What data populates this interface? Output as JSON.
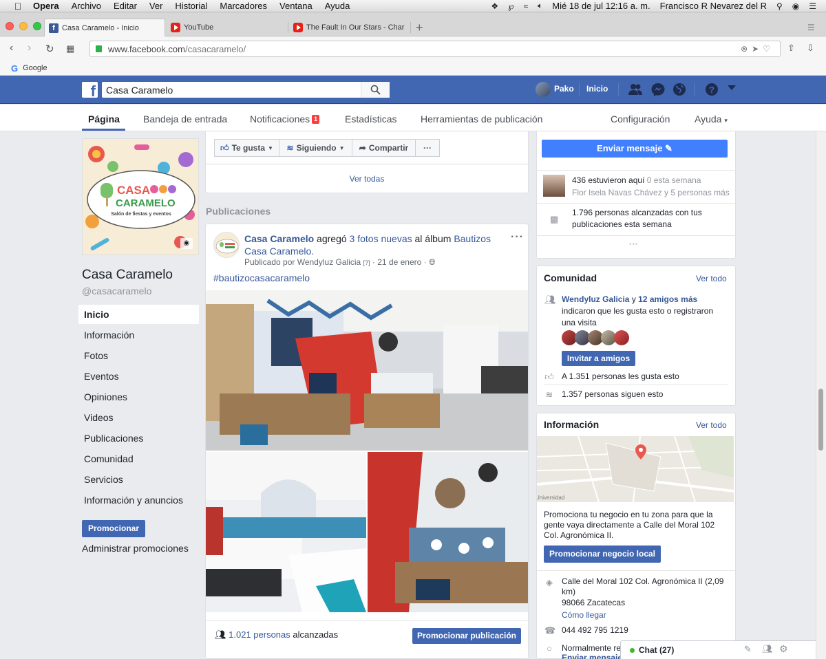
{
  "menubar": {
    "app": "Opera",
    "items": [
      "Archivo",
      "Editar",
      "Ver",
      "Historial",
      "Marcadores",
      "Ventana",
      "Ayuda"
    ],
    "datetime": "Mié 18 de jul  12:16 a. m.",
    "user": "Francisco R Nevarez del R"
  },
  "tabs": [
    {
      "title": "Casa Caramelo - Inicio",
      "icon": "facebook-icon",
      "active": true
    },
    {
      "title": "YouTube",
      "icon": "youtube-icon",
      "active": false
    },
    {
      "title": "The Fault In Our Stars - Char",
      "icon": "youtube-icon",
      "active": false
    }
  ],
  "address": {
    "host": "www.facebook.com",
    "path": "/casacaramelo/"
  },
  "bookmarks": [
    {
      "label": "Google"
    }
  ],
  "fb_header": {
    "search_value": "Casa Caramelo",
    "user": "Pako",
    "home": "Inicio"
  },
  "page_nav": {
    "items": [
      "Página",
      "Bandeja de entrada",
      "Notificaciones",
      "Estadísticas",
      "Herramientas de publicación"
    ],
    "notif_count": "1",
    "config": "Configuración",
    "help": "Ayuda"
  },
  "left": {
    "cover_brand_1": "CASA",
    "cover_brand_2": "CARAMELO",
    "cover_tagline": "Salón de fiestas y eventos",
    "page_name": "Casa Caramelo",
    "handle": "@casacaramelo",
    "nav": [
      "Inicio",
      "Información",
      "Fotos",
      "Eventos",
      "Opiniones",
      "Videos",
      "Publicaciones",
      "Comunidad",
      "Servicios",
      "Información y anuncios"
    ],
    "promote": "Promocionar",
    "manage_promos": "Administrar promociones"
  },
  "actions": {
    "like": "Te gusta",
    "following": "Siguiendo",
    "share": "Compartir",
    "more": "···",
    "see_all": "Ver todas"
  },
  "posts_heading": "Publicaciones",
  "post": {
    "author": "Casa Caramelo",
    "text_1": " agregó ",
    "photos_link": "3 fotos nuevas",
    "text_2": " al álbum ",
    "album": "Bautizos Casa Caramelo.",
    "meta_by": "Publicado por Wendyluz Galicia",
    "meta_q": "[?]",
    "meta_date": "· 21 de enero ·",
    "hashtag": "#bautizocasacaramelo",
    "reach_count": "1.021 personas",
    "reach_suffix": " alcanzadas",
    "promote_btn": "Promocionar publicación"
  },
  "right": {
    "send_message": "Enviar mensaje",
    "checkins": "436 estuvieron aquí",
    "checkins_week": " 0 esta semana",
    "visitors": "Flor Isela Navas Chávez",
    "visitors_more": " y 5 personas más",
    "reached": "1.796 personas alcanzadas con tus publicaciones esta semana",
    "community": {
      "title": "Comunidad",
      "see_all": "Ver todo",
      "friend": "Wendyluz Galicia",
      "and": " y ",
      "friends_more": "12 amigos más",
      "friends_text": "indicaron que les gusta esto o registraron una visita",
      "invite": "Invitar a amigos",
      "likes": "A 1.351 personas les gusta esto",
      "follows": "1.357 personas siguen esto"
    },
    "info": {
      "title": "Información",
      "see_all": "Ver todo",
      "map_label": "Universidad",
      "promo_text": "Promociona tu negocio en tu zona para que la gente vaya directamente a Calle del Moral 102 Col. Agronómica II.",
      "promo_btn": "Promocionar negocio local",
      "address": "Calle del Moral 102 Col. Agronómica II (2,09 km)",
      "zip": "98066 Zacatecas",
      "directions": "Cómo llegar",
      "phone": "044 492 795 1219",
      "response": "Normalmente re",
      "send_msg": "Enviar mensaje"
    }
  },
  "chat": {
    "label": "Chat (27)"
  },
  "colors": {
    "fb_blue": "#4267b2",
    "messenger_blue": "#4080ff",
    "link": "#365899"
  }
}
